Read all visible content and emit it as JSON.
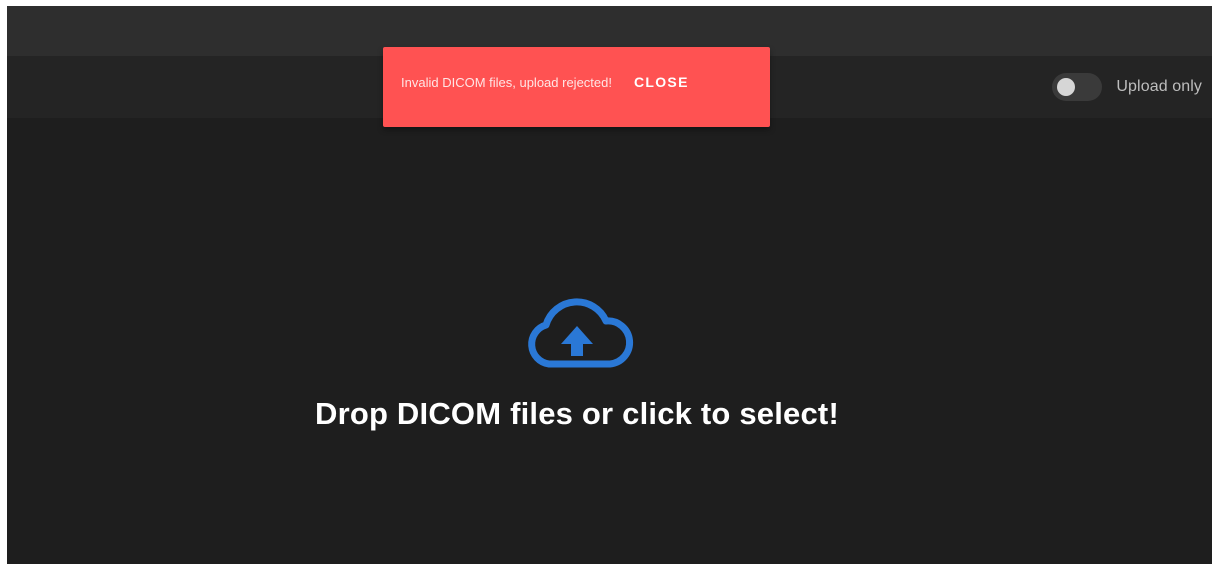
{
  "snackbar": {
    "message": "Invalid DICOM files, upload rejected!",
    "close_label": "CLOSE",
    "color": "#ff5252"
  },
  "upload_toggle": {
    "label": "Upload only",
    "on": false
  },
  "dropzone": {
    "icon": "cloud-upload-icon",
    "icon_color": "#2a78d6",
    "text": "Drop DICOM files or click to select!"
  }
}
